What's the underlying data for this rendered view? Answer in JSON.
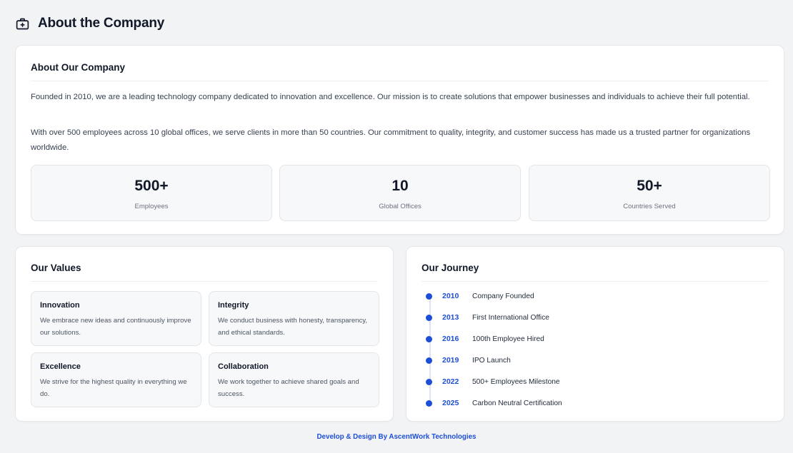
{
  "header": {
    "title": "About the Company",
    "icon": "briefcase-icon"
  },
  "about": {
    "title": "About Our Company",
    "paragraphs": [
      "Founded in 2010, we are a leading technology company dedicated to innovation and excellence. Our mission is to create solutions that empower businesses and individuals to achieve their full potential.",
      "With over 500 employees across 10 global offices, we serve clients in more than 50 countries. Our commitment to quality, integrity, and customer success has made us a trusted partner for organizations worldwide."
    ],
    "stats": [
      {
        "value": "500+",
        "label": "Employees"
      },
      {
        "value": "10",
        "label": "Global Offices"
      },
      {
        "value": "50+",
        "label": "Countries Served"
      }
    ]
  },
  "values": {
    "title": "Our Values",
    "items": [
      {
        "title": "Innovation",
        "description": "We embrace new ideas and continuously improve our solutions."
      },
      {
        "title": "Integrity",
        "description": "We conduct business with honesty, transparency, and ethical standards."
      },
      {
        "title": "Excellence",
        "description": "We strive for the highest quality in everything we do."
      },
      {
        "title": "Collaboration",
        "description": "We work together to achieve shared goals and success."
      }
    ]
  },
  "journey": {
    "title": "Our Journey",
    "items": [
      {
        "year": "2010",
        "event": "Company Founded"
      },
      {
        "year": "2013",
        "event": "First International Office"
      },
      {
        "year": "2016",
        "event": "100th Employee Hired"
      },
      {
        "year": "2019",
        "event": "IPO Launch"
      },
      {
        "year": "2022",
        "event": "500+ Employees Milestone"
      },
      {
        "year": "2025",
        "event": "Carbon Neutral Certification"
      }
    ]
  },
  "footer": {
    "text": "Develop & Design By AscentWork Technologies"
  },
  "colors": {
    "accent": "#1d4ed8",
    "background": "#f2f3f5",
    "card": "#ffffff"
  }
}
